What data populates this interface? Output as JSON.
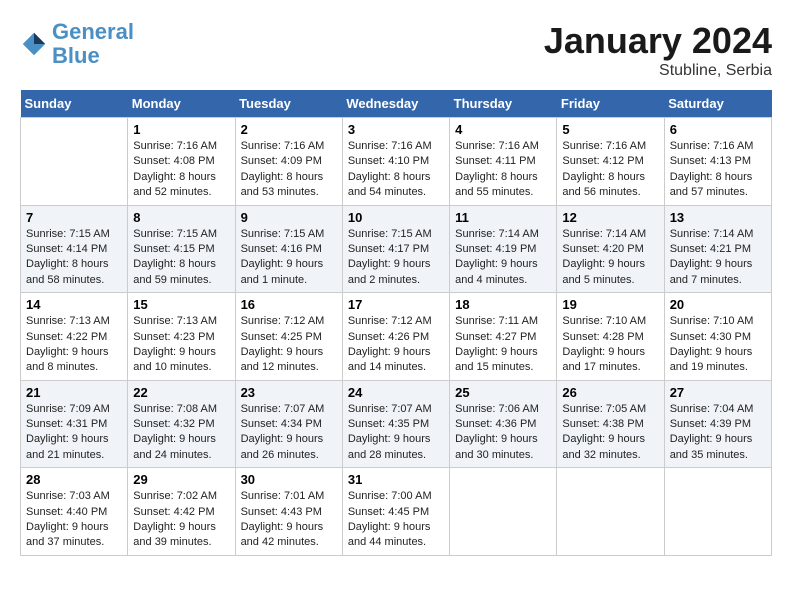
{
  "header": {
    "logo_line1": "General",
    "logo_line2": "Blue",
    "month": "January 2024",
    "location": "Stubline, Serbia"
  },
  "weekdays": [
    "Sunday",
    "Monday",
    "Tuesday",
    "Wednesday",
    "Thursday",
    "Friday",
    "Saturday"
  ],
  "weeks": [
    [
      {
        "day": "",
        "info": ""
      },
      {
        "day": "1",
        "info": "Sunrise: 7:16 AM\nSunset: 4:08 PM\nDaylight: 8 hours\nand 52 minutes."
      },
      {
        "day": "2",
        "info": "Sunrise: 7:16 AM\nSunset: 4:09 PM\nDaylight: 8 hours\nand 53 minutes."
      },
      {
        "day": "3",
        "info": "Sunrise: 7:16 AM\nSunset: 4:10 PM\nDaylight: 8 hours\nand 54 minutes."
      },
      {
        "day": "4",
        "info": "Sunrise: 7:16 AM\nSunset: 4:11 PM\nDaylight: 8 hours\nand 55 minutes."
      },
      {
        "day": "5",
        "info": "Sunrise: 7:16 AM\nSunset: 4:12 PM\nDaylight: 8 hours\nand 56 minutes."
      },
      {
        "day": "6",
        "info": "Sunrise: 7:16 AM\nSunset: 4:13 PM\nDaylight: 8 hours\nand 57 minutes."
      }
    ],
    [
      {
        "day": "7",
        "info": "Sunrise: 7:15 AM\nSunset: 4:14 PM\nDaylight: 8 hours\nand 58 minutes."
      },
      {
        "day": "8",
        "info": "Sunrise: 7:15 AM\nSunset: 4:15 PM\nDaylight: 8 hours\nand 59 minutes."
      },
      {
        "day": "9",
        "info": "Sunrise: 7:15 AM\nSunset: 4:16 PM\nDaylight: 9 hours\nand 1 minute."
      },
      {
        "day": "10",
        "info": "Sunrise: 7:15 AM\nSunset: 4:17 PM\nDaylight: 9 hours\nand 2 minutes."
      },
      {
        "day": "11",
        "info": "Sunrise: 7:14 AM\nSunset: 4:19 PM\nDaylight: 9 hours\nand 4 minutes."
      },
      {
        "day": "12",
        "info": "Sunrise: 7:14 AM\nSunset: 4:20 PM\nDaylight: 9 hours\nand 5 minutes."
      },
      {
        "day": "13",
        "info": "Sunrise: 7:14 AM\nSunset: 4:21 PM\nDaylight: 9 hours\nand 7 minutes."
      }
    ],
    [
      {
        "day": "14",
        "info": "Sunrise: 7:13 AM\nSunset: 4:22 PM\nDaylight: 9 hours\nand 8 minutes."
      },
      {
        "day": "15",
        "info": "Sunrise: 7:13 AM\nSunset: 4:23 PM\nDaylight: 9 hours\nand 10 minutes."
      },
      {
        "day": "16",
        "info": "Sunrise: 7:12 AM\nSunset: 4:25 PM\nDaylight: 9 hours\nand 12 minutes."
      },
      {
        "day": "17",
        "info": "Sunrise: 7:12 AM\nSunset: 4:26 PM\nDaylight: 9 hours\nand 14 minutes."
      },
      {
        "day": "18",
        "info": "Sunrise: 7:11 AM\nSunset: 4:27 PM\nDaylight: 9 hours\nand 15 minutes."
      },
      {
        "day": "19",
        "info": "Sunrise: 7:10 AM\nSunset: 4:28 PM\nDaylight: 9 hours\nand 17 minutes."
      },
      {
        "day": "20",
        "info": "Sunrise: 7:10 AM\nSunset: 4:30 PM\nDaylight: 9 hours\nand 19 minutes."
      }
    ],
    [
      {
        "day": "21",
        "info": "Sunrise: 7:09 AM\nSunset: 4:31 PM\nDaylight: 9 hours\nand 21 minutes."
      },
      {
        "day": "22",
        "info": "Sunrise: 7:08 AM\nSunset: 4:32 PM\nDaylight: 9 hours\nand 24 minutes."
      },
      {
        "day": "23",
        "info": "Sunrise: 7:07 AM\nSunset: 4:34 PM\nDaylight: 9 hours\nand 26 minutes."
      },
      {
        "day": "24",
        "info": "Sunrise: 7:07 AM\nSunset: 4:35 PM\nDaylight: 9 hours\nand 28 minutes."
      },
      {
        "day": "25",
        "info": "Sunrise: 7:06 AM\nSunset: 4:36 PM\nDaylight: 9 hours\nand 30 minutes."
      },
      {
        "day": "26",
        "info": "Sunrise: 7:05 AM\nSunset: 4:38 PM\nDaylight: 9 hours\nand 32 minutes."
      },
      {
        "day": "27",
        "info": "Sunrise: 7:04 AM\nSunset: 4:39 PM\nDaylight: 9 hours\nand 35 minutes."
      }
    ],
    [
      {
        "day": "28",
        "info": "Sunrise: 7:03 AM\nSunset: 4:40 PM\nDaylight: 9 hours\nand 37 minutes."
      },
      {
        "day": "29",
        "info": "Sunrise: 7:02 AM\nSunset: 4:42 PM\nDaylight: 9 hours\nand 39 minutes."
      },
      {
        "day": "30",
        "info": "Sunrise: 7:01 AM\nSunset: 4:43 PM\nDaylight: 9 hours\nand 42 minutes."
      },
      {
        "day": "31",
        "info": "Sunrise: 7:00 AM\nSunset: 4:45 PM\nDaylight: 9 hours\nand 44 minutes."
      },
      {
        "day": "",
        "info": ""
      },
      {
        "day": "",
        "info": ""
      },
      {
        "day": "",
        "info": ""
      }
    ]
  ]
}
